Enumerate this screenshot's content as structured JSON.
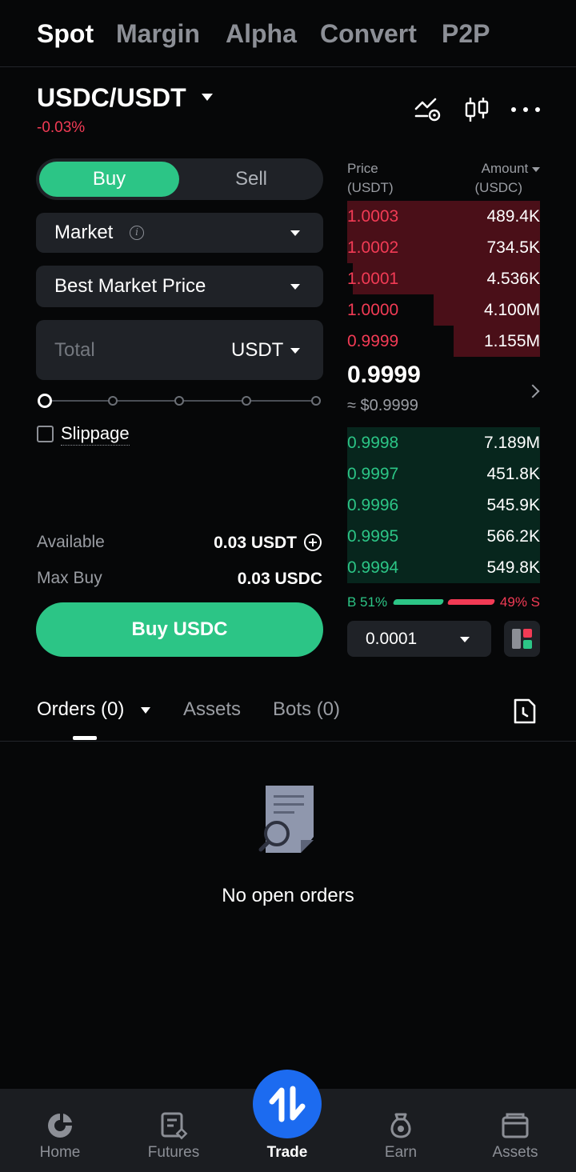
{
  "top_tabs": [
    "Spot",
    "Margin",
    "Alpha",
    "Convert",
    "P2P"
  ],
  "pair": {
    "name": "USDC/USDT",
    "change": "-0.03%"
  },
  "order_form": {
    "buy_label": "Buy",
    "sell_label": "Sell",
    "order_type": "Market",
    "price_mode": "Best Market Price",
    "total_placeholder": "Total",
    "total_unit": "USDT",
    "slider_percent": 0,
    "slippage_label": "Slippage",
    "slippage_checked": false,
    "available_label": "Available",
    "available_value": "0.03 USDT",
    "max_buy_label": "Max Buy",
    "max_buy_value": "0.03 USDC",
    "submit_label": "Buy USDC"
  },
  "order_book": {
    "price_header": "Price",
    "price_unit": "(USDT)",
    "amount_header": "Amount",
    "amount_unit": "(USDC)",
    "asks": [
      {
        "price": "1.0003",
        "amount": "489.4K",
        "depth": 1.0
      },
      {
        "price": "1.0002",
        "amount": "734.5K",
        "depth": 1.0
      },
      {
        "price": "1.0001",
        "amount": "4.536K",
        "depth": 0.97
      },
      {
        "price": "1.0000",
        "amount": "4.100M",
        "depth": 0.55
      },
      {
        "price": "0.9999",
        "amount": "1.155M",
        "depth": 0.45
      }
    ],
    "mid_price": "0.9999",
    "mid_usd": "≈ $0.9999",
    "bids": [
      {
        "price": "0.9998",
        "amount": "7.189M",
        "depth": 1.0
      },
      {
        "price": "0.9997",
        "amount": "451.8K",
        "depth": 1.0
      },
      {
        "price": "0.9996",
        "amount": "545.9K",
        "depth": 1.0
      },
      {
        "price": "0.9995",
        "amount": "566.2K",
        "depth": 1.0
      },
      {
        "price": "0.9994",
        "amount": "549.8K",
        "depth": 1.0
      }
    ],
    "buy_ratio": "B 51%",
    "sell_ratio": "49% S",
    "precision": "0.0001"
  },
  "bottom_tabs": {
    "orders": "Orders (0)",
    "assets": "Assets",
    "bots": "Bots (0)"
  },
  "empty_state": "No open orders",
  "nav": [
    {
      "label": "Home",
      "icon": "home-icon"
    },
    {
      "label": "Futures",
      "icon": "futures-icon"
    },
    {
      "label": "Trade",
      "icon": "trade-icon"
    },
    {
      "label": "Earn",
      "icon": "earn-icon"
    },
    {
      "label": "Assets",
      "icon": "wallet-icon"
    }
  ],
  "colors": {
    "green": "#2cc586",
    "red": "#f23b55",
    "blue": "#1c6bf0",
    "background": "#060708"
  }
}
